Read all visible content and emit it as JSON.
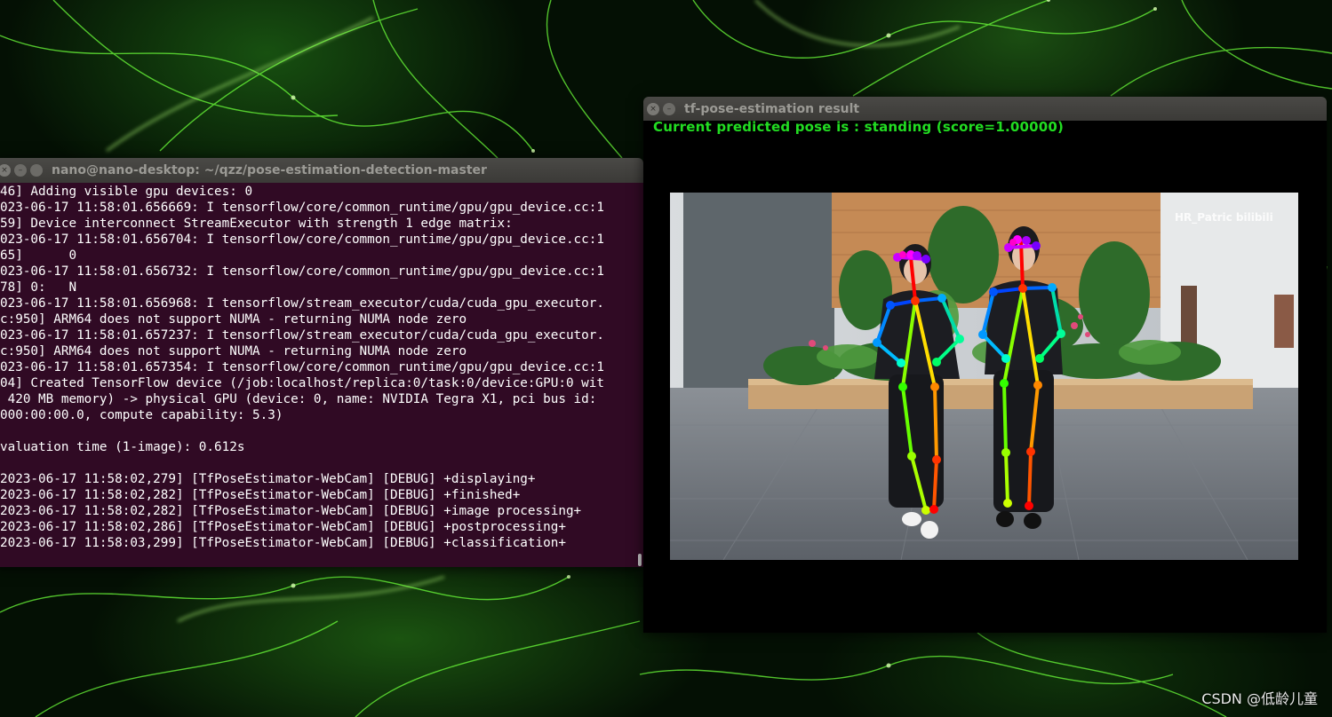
{
  "terminal": {
    "title": "nano@nano-desktop: ~/qzz/pose-estimation-detection-master",
    "lines": [
      "46] Adding visible gpu devices: 0",
      "023-06-17 11:58:01.656669: I tensorflow/core/common_runtime/gpu/gpu_device.cc:1",
      "59] Device interconnect StreamExecutor with strength 1 edge matrix:",
      "023-06-17 11:58:01.656704: I tensorflow/core/common_runtime/gpu/gpu_device.cc:1",
      "65]      0",
      "023-06-17 11:58:01.656732: I tensorflow/core/common_runtime/gpu/gpu_device.cc:1",
      "78] 0:   N",
      "023-06-17 11:58:01.656968: I tensorflow/stream_executor/cuda/cuda_gpu_executor.",
      "c:950] ARM64 does not support NUMA - returning NUMA node zero",
      "023-06-17 11:58:01.657237: I tensorflow/stream_executor/cuda/cuda_gpu_executor.",
      "c:950] ARM64 does not support NUMA - returning NUMA node zero",
      "023-06-17 11:58:01.657354: I tensorflow/core/common_runtime/gpu/gpu_device.cc:1",
      "04] Created TensorFlow device (/job:localhost/replica:0/task:0/device:GPU:0 wit",
      " 420 MB memory) -> physical GPU (device: 0, name: NVIDIA Tegra X1, pci bus id:",
      "000:00:00.0, compute capability: 5.3)",
      "",
      "valuation time (1-image): 0.612s",
      "",
      "2023-06-17 11:58:02,279] [TfPoseEstimator-WebCam] [DEBUG] +displaying+",
      "2023-06-17 11:58:02,282] [TfPoseEstimator-WebCam] [DEBUG] +finished+",
      "2023-06-17 11:58:02,282] [TfPoseEstimator-WebCam] [DEBUG] +image processing+",
      "2023-06-17 11:58:02,286] [TfPoseEstimator-WebCam] [DEBUG] +postprocessing+",
      "2023-06-17 11:58:03,299] [TfPoseEstimator-WebCam] [DEBUG] +classification+"
    ]
  },
  "result_window": {
    "title": "tf-pose-estimation result",
    "status_text": "Current predicted pose is : standing (score=1.00000)",
    "video_watermark": "HR_Patric bilibili"
  },
  "window_buttons": {
    "close": "×",
    "minimize": "–"
  },
  "watermark": "CSDN @低龄儿童",
  "icons": [
    "close-icon",
    "minimize-icon"
  ]
}
